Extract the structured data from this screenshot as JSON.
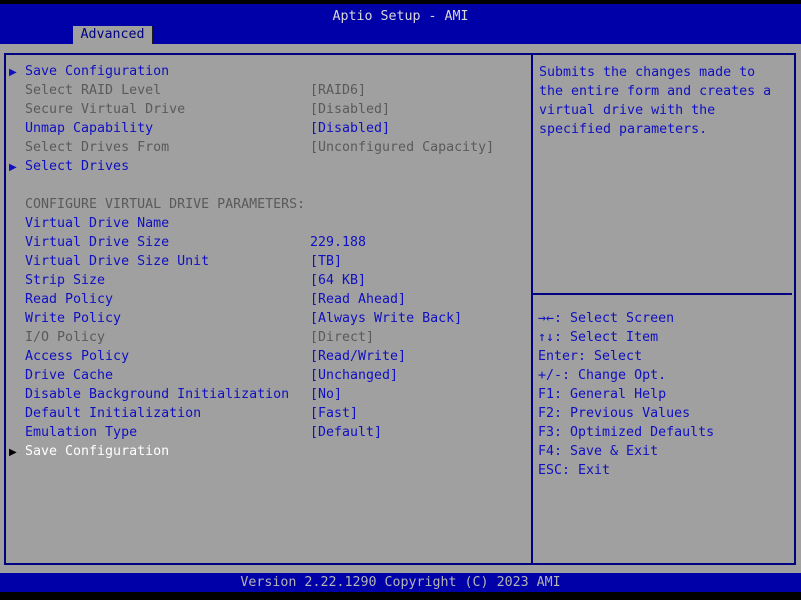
{
  "header": {
    "title": "Aptio Setup - AMI",
    "tab": "Advanced"
  },
  "icons": {
    "submenu_arrow": "▶"
  },
  "menu": {
    "items": [
      {
        "label": "Save Configuration",
        "value": "",
        "state": "normal",
        "arrow": true
      },
      {
        "label": "Select RAID Level",
        "value": "[RAID6]",
        "state": "dim",
        "arrow": false
      },
      {
        "label": "Secure Virtual Drive",
        "value": "[Disabled]",
        "state": "dim",
        "arrow": false
      },
      {
        "label": "Unmap Capability",
        "value": "[Disabled]",
        "state": "normal",
        "arrow": false
      },
      {
        "label": "Select Drives From",
        "value": "[Unconfigured Capacity]",
        "state": "dim",
        "arrow": false
      },
      {
        "label": "Select Drives",
        "value": "",
        "state": "normal",
        "arrow": true
      },
      {
        "label": "",
        "value": "",
        "state": "dim",
        "arrow": false
      },
      {
        "label": "CONFIGURE VIRTUAL DRIVE PARAMETERS:",
        "value": "",
        "state": "dim",
        "arrow": false
      },
      {
        "label": "Virtual Drive Name",
        "value": "",
        "state": "normal",
        "arrow": false
      },
      {
        "label": "Virtual Drive Size",
        "value": "229.188",
        "state": "normal",
        "arrow": false
      },
      {
        "label": "Virtual Drive Size Unit",
        "value": "[TB]",
        "state": "normal",
        "arrow": false
      },
      {
        "label": "Strip Size",
        "value": "[64 KB]",
        "state": "normal",
        "arrow": false
      },
      {
        "label": "Read Policy",
        "value": "[Read Ahead]",
        "state": "normal",
        "arrow": false
      },
      {
        "label": "Write Policy",
        "value": "[Always Write Back]",
        "state": "normal",
        "arrow": false
      },
      {
        "label": "I/O Policy",
        "value": "[Direct]",
        "state": "dim",
        "arrow": false
      },
      {
        "label": "Access Policy",
        "value": "[Read/Write]",
        "state": "normal",
        "arrow": false
      },
      {
        "label": "Drive Cache",
        "value": "[Unchanged]",
        "state": "normal",
        "arrow": false
      },
      {
        "label": "Disable Background Initialization",
        "value": "[No]",
        "state": "normal",
        "arrow": false
      },
      {
        "label": "Default Initialization",
        "value": "[Fast]",
        "state": "normal",
        "arrow": false
      },
      {
        "label": "Emulation Type",
        "value": "[Default]",
        "state": "normal",
        "arrow": false
      },
      {
        "label": "Save Configuration",
        "value": "",
        "state": "selected",
        "arrow": true
      }
    ]
  },
  "help_text": {
    "lines": [
      "Submits the changes made to",
      "the entire form and creates a",
      "virtual drive with the",
      "specified parameters."
    ]
  },
  "hints": [
    "→←: Select Screen",
    "↑↓: Select Item",
    "Enter: Select",
    "+/-: Change Opt.",
    "F1: General Help",
    "F2: Previous Values",
    "F3: Optimized Defaults",
    "F4: Save & Exit",
    "ESC: Exit"
  ],
  "footer": {
    "version_text": "Version 2.22.1290 Copyright (C) 2023 AMI"
  },
  "colors": {
    "header_blue": "#0000a8",
    "border_navy": "#000080",
    "background_gray": "#a0a0a0",
    "item_blue": "#1010c0",
    "dim_gray": "#5a5a5a",
    "selected_white": "#ffffff",
    "title_gray": "#d8d8d8",
    "footer_gray": "#b4b4b4"
  }
}
